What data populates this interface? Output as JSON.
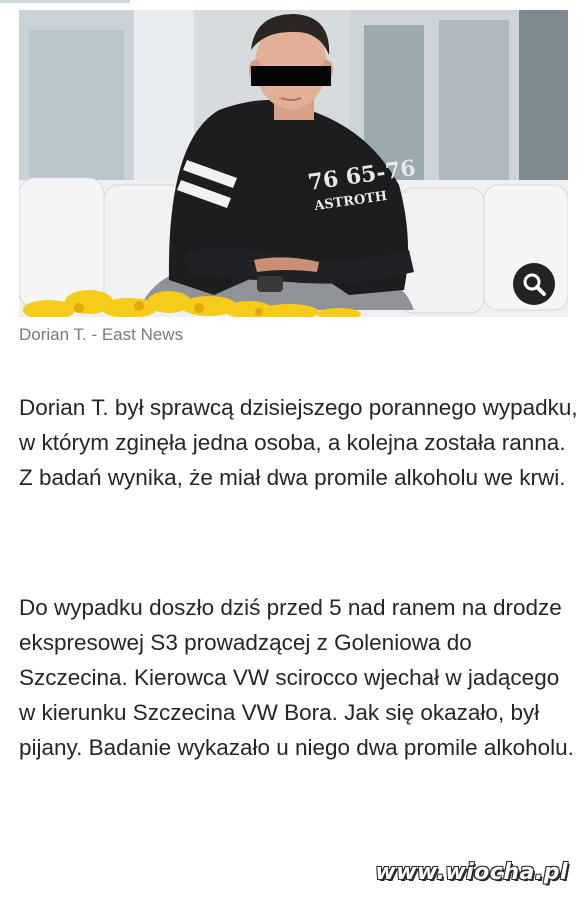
{
  "article": {
    "image": {
      "alt": "",
      "zoom_icon": "magnifier-icon",
      "shirt_text_line1": "76 65-76",
      "shirt_text_line2": "ASTROTH"
    },
    "caption": {
      "text": "Dorian T. - East News"
    },
    "paragraphs": [
      "Dorian T. był sprawcą dzisiejszego porannego wypadku, w którym zginęła jedna osoba, a kolejna została ranna. Z badań wynika, że miał dwa promile alkoholu we krwi.",
      "Do wypadku doszło dziś przed 5 nad ranem na drodze ekspresowej S3 prowadzącej z Goleniowa do Szczecina. Kierowca VW scirocco wjechał w jadącego w kierunku Szczecina VW Bora. Jak się okazało, był pijany. Badanie wykazało u niego dwa promile alkoholu."
    ]
  },
  "watermark": {
    "text": "www.wiocha.pl"
  },
  "colors": {
    "text": "#262626",
    "caption": "#7a7a7a",
    "zoom_button": "#232323"
  }
}
